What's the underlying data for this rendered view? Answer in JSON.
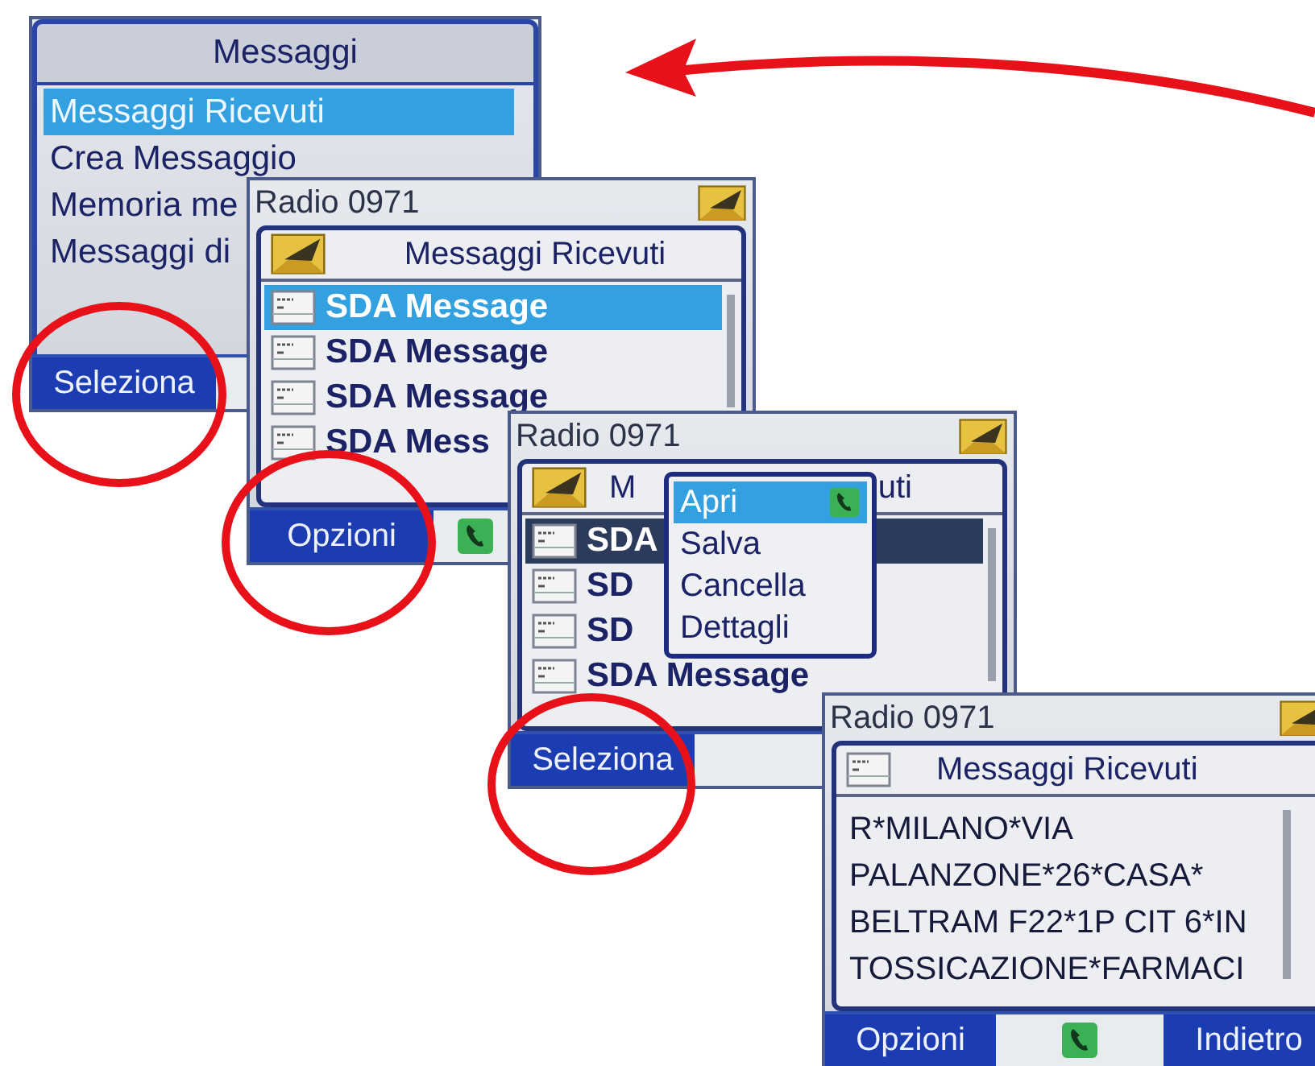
{
  "screens": [
    {
      "kind": "menu",
      "title": "Messaggi",
      "items": [
        {
          "label": "Messaggi Ricevuti",
          "selected": true
        },
        {
          "label": "Crea Messaggio",
          "selected": false
        },
        {
          "label": "Memoria me",
          "selected": false
        },
        {
          "label": "Messaggi di",
          "selected": false
        }
      ],
      "softkeys": {
        "left": "Seleziona"
      }
    },
    {
      "kind": "list",
      "header": "Radio 0971",
      "title": "Messaggi Ricevuti",
      "items": [
        {
          "label": "SDA Message",
          "selected": true
        },
        {
          "label": "SDA Message",
          "selected": false
        },
        {
          "label": "SDA Message",
          "selected": false
        },
        {
          "label": "SDA Mess",
          "selected": false
        }
      ],
      "softkeys": {
        "left": "Opzioni",
        "call": true
      }
    },
    {
      "kind": "popup",
      "header": "Radio 0971",
      "title_parts": [
        "M",
        "uti"
      ],
      "items": [
        {
          "label": "SDA",
          "selected": true
        },
        {
          "label": "SD",
          "selected": false
        },
        {
          "label": "SD",
          "selected": false
        },
        {
          "label": "SDA Message",
          "selected": false
        }
      ],
      "popup": [
        {
          "label": "Apri",
          "selected": true,
          "call": true
        },
        {
          "label": "Salva",
          "selected": false,
          "call": false
        },
        {
          "label": "Cancella",
          "selected": false,
          "call": false
        },
        {
          "label": "Dettagli",
          "selected": false,
          "call": false
        }
      ],
      "softkeys": {
        "left": "Seleziona"
      }
    },
    {
      "kind": "message",
      "header": "Radio 0971",
      "title": "Messaggi Ricevuti",
      "lines": [
        "R*MILANO*VIA",
        "PALANZONE*26*CASA*",
        "BELTRAM F22*1P CIT 6*IN",
        "TOSSICAZIONE*FARMACI"
      ],
      "softkeys": {
        "left": "Opzioni",
        "call": true,
        "right": "Indietro"
      }
    }
  ]
}
